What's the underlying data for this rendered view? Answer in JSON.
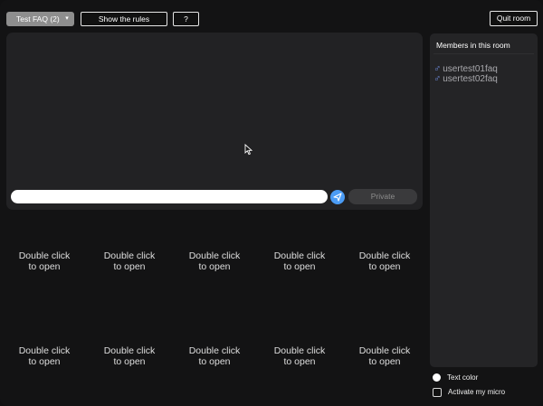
{
  "toolbar": {
    "room_select_value": "Test FAQ (2)",
    "rules_label": "Show the rules",
    "help_label": "?",
    "quit_label": "Quit room"
  },
  "chat": {
    "input_value": "",
    "private_label": "Private"
  },
  "grid": {
    "cells": [
      {
        "line1": "Double click",
        "line2": "to open"
      },
      {
        "line1": "Double click",
        "line2": "to open"
      },
      {
        "line1": "Double click",
        "line2": "to open"
      },
      {
        "line1": "Double click",
        "line2": "to open"
      },
      {
        "line1": "Double click",
        "line2": "to open"
      },
      {
        "line1": "Double click",
        "line2": "to open"
      },
      {
        "line1": "Double click",
        "line2": "to open"
      },
      {
        "line1": "Double click",
        "line2": "to open"
      },
      {
        "line1": "Double click",
        "line2": "to open"
      },
      {
        "line1": "Double click",
        "line2": "to open"
      }
    ]
  },
  "members": {
    "title": "Members in this room",
    "gender_symbol": "♂",
    "list": [
      {
        "name": "usertest01faq"
      },
      {
        "name": "usertest02faq"
      }
    ]
  },
  "options": {
    "text_color_label": "Text color",
    "micro_label": "Activate my micro"
  },
  "colors": {
    "accent": "#4b9cf5",
    "male": "#6f8ce0"
  }
}
